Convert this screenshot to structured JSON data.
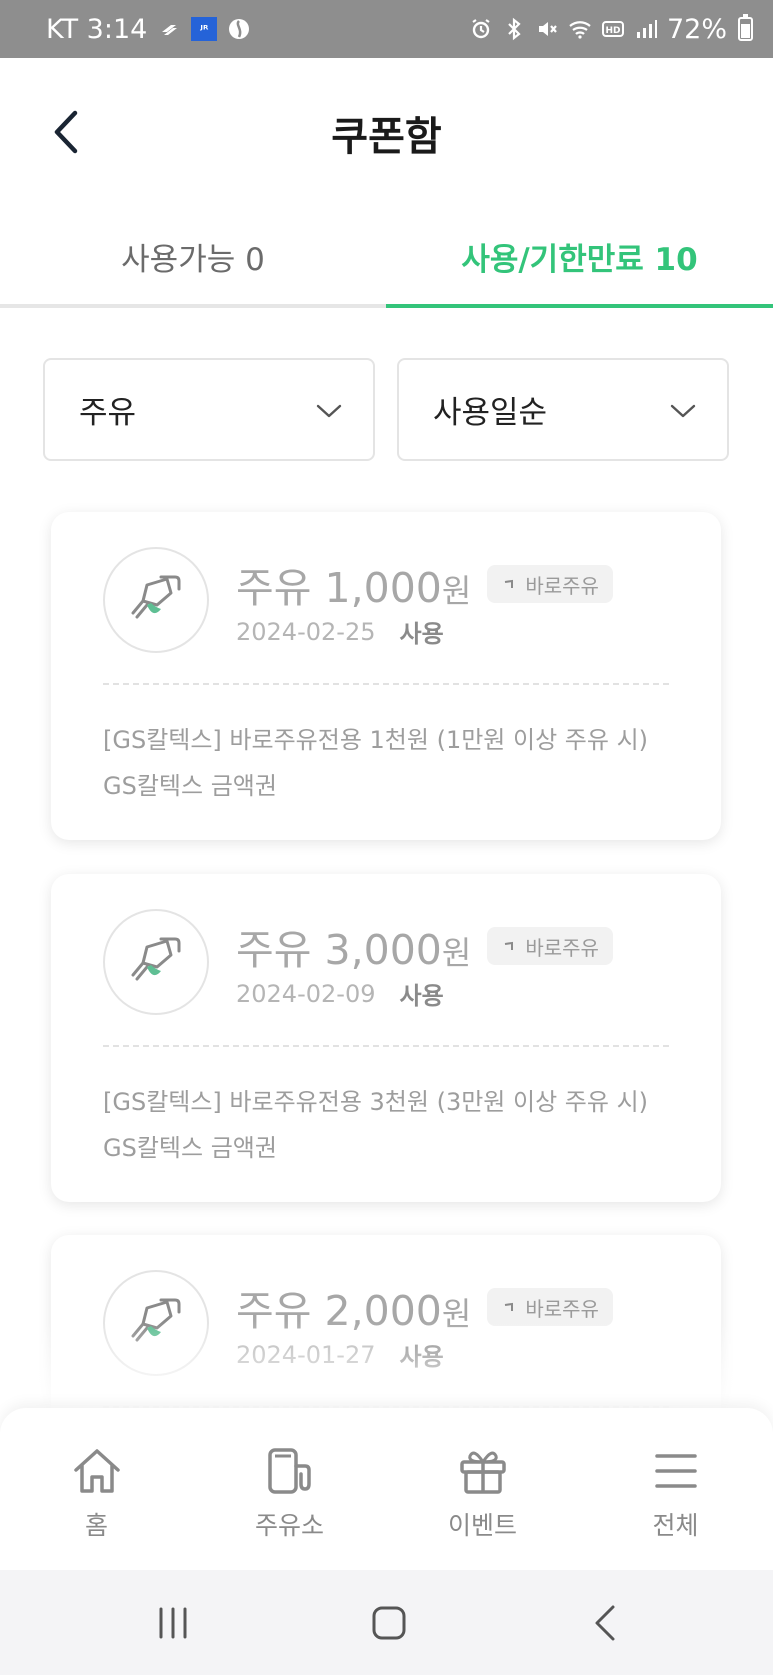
{
  "status_bar": {
    "carrier_time": "KT 3:14",
    "app_icon_label": "ᴶᴿ",
    "battery": "72%",
    "icons": [
      "s-icon",
      "jr-app-icon",
      "swirl-icon",
      "alarm-icon",
      "bluetooth-icon",
      "mute-icon",
      "wifi-icon",
      "hd-icon",
      "signal-icon",
      "battery-icon"
    ]
  },
  "header": {
    "title": "쿠폰함",
    "back_icon": "chevron-left-icon"
  },
  "tabs": [
    {
      "label": "사용가능 0",
      "active": false
    },
    {
      "label": "사용/기한만료 10",
      "active": true
    }
  ],
  "filters": [
    {
      "value": "주유"
    },
    {
      "value": "사용일순"
    }
  ],
  "coupons": [
    {
      "category": "주유",
      "amount": "1,000",
      "currency": "원",
      "badge": "바로주유",
      "date": "2024-02-25",
      "status": "사용",
      "description": "[GS칼텍스] 바로주유전용 1천원 (1만원 이상 주유 시)",
      "type": "GS칼텍스 금액권"
    },
    {
      "category": "주유",
      "amount": "3,000",
      "currency": "원",
      "badge": "바로주유",
      "date": "2024-02-09",
      "status": "사용",
      "description": "[GS칼텍스] 바로주유전용 3천원 (3만원 이상 주유 시)",
      "type": "GS칼텍스 금액권"
    },
    {
      "category": "주유",
      "amount": "2,000",
      "currency": "원",
      "badge": "바로주유",
      "date": "2024-01-27",
      "status": "사용"
    }
  ],
  "bottom_nav": [
    {
      "label": "홈",
      "icon": "home-icon"
    },
    {
      "label": "주유소",
      "icon": "gas-station-icon"
    },
    {
      "label": "이벤트",
      "icon": "gift-icon"
    },
    {
      "label": "전체",
      "icon": "menu-icon"
    }
  ],
  "colors": {
    "accent": "#33c47a",
    "status_bar": "#8e8e8e",
    "muted_text": "#a7a7a7"
  }
}
